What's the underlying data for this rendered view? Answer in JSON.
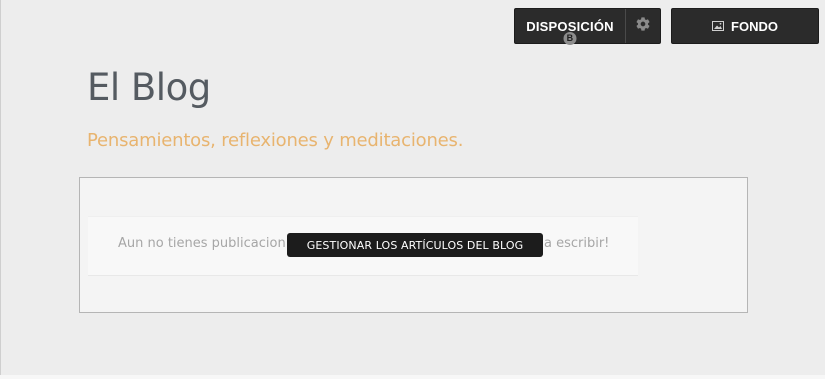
{
  "toolbar": {
    "layout_label": "DISPOSICIÓN",
    "layout_badge": "B",
    "settings_icon": "gear-icon",
    "background_label": "FONDO",
    "background_icon": "image-icon"
  },
  "header": {
    "title": "El Blog",
    "subtitle": "Pensamientos, reflexiones y meditaciones."
  },
  "posts": {
    "empty_text_start": "Aun no tienes publicacion",
    "manage_label": "GESTIONAR LOS ARTÍCULOS DEL BLOG",
    "empty_text_end": "a escribir!"
  },
  "colors": {
    "background": "#ededed",
    "title": "#555b61",
    "subtitle_accent": "#e8b46f",
    "toolbar_button": "#2b2b2b"
  }
}
